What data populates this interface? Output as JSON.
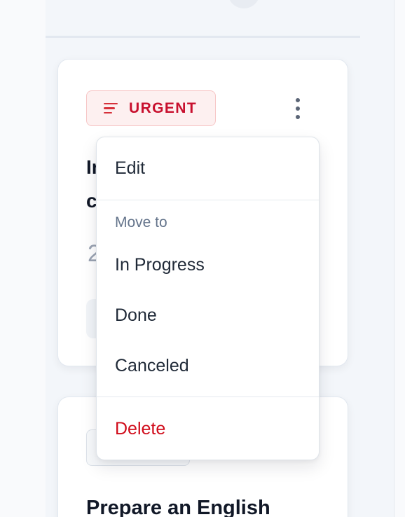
{
  "card": {
    "priority_label": "URGENT",
    "title_fragment_1": "In",
    "title_fragment_2": "c",
    "meta_fragment": "2"
  },
  "card_next": {
    "title": "Prepare an English"
  },
  "menu": {
    "edit": "Edit",
    "move_heading": "Move to",
    "in_progress": "In Progress",
    "done": "Done",
    "canceled": "Canceled",
    "delete": "Delete"
  },
  "colors": {
    "urgent_text": "#c8102e",
    "delete_text": "#d00b1a",
    "menu_text": "#1f2937",
    "heading_text": "#64748b"
  }
}
